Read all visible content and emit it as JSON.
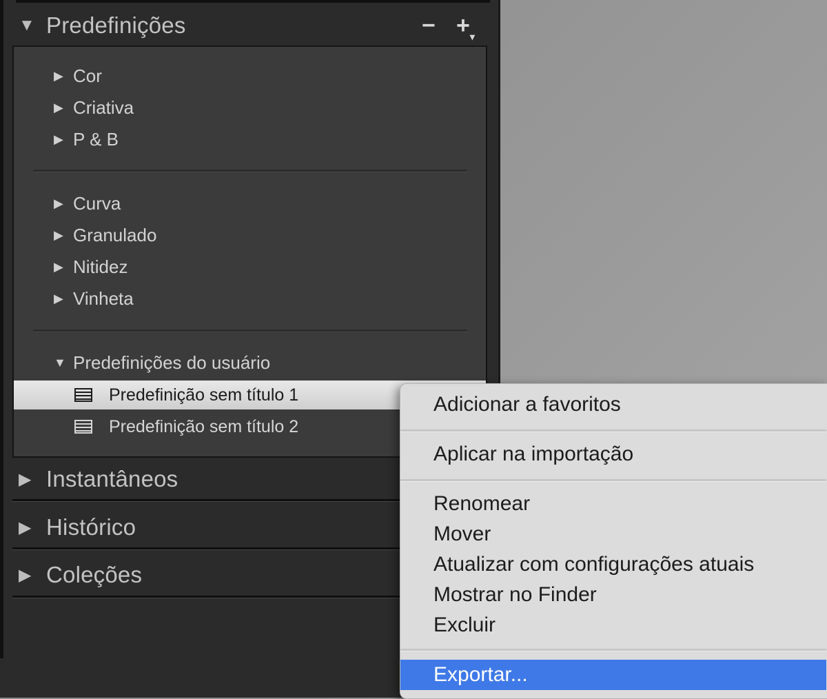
{
  "colors": {
    "panel_bg": "#2b2b2b",
    "box_bg": "#3b3b3b",
    "menu_bg": "#dcdcdc",
    "menu_highlight": "#3f79e8"
  },
  "panel": {
    "header": {
      "title": "Predefinições",
      "minus": "−",
      "plus": "+"
    },
    "groups": [
      {
        "items": [
          "Cor",
          "Criativa",
          "P & B"
        ]
      },
      {
        "items": [
          "Curva",
          "Granulado",
          "Nitidez",
          "Vinheta"
        ]
      }
    ],
    "user_group": {
      "label": "Predefinições do usuário",
      "presets": [
        "Predefinição sem título 1",
        "Predefinição sem título 2"
      ]
    },
    "sections": [
      "Instantâneos",
      "Histórico",
      "Coleções"
    ]
  },
  "context_menu": {
    "items": [
      "Adicionar a favoritos",
      "Aplicar na importação",
      "Renomear",
      "Mover",
      "Atualizar com configurações atuais",
      "Mostrar no Finder",
      "Excluir",
      "Exportar..."
    ],
    "highlighted": "Exportar..."
  }
}
